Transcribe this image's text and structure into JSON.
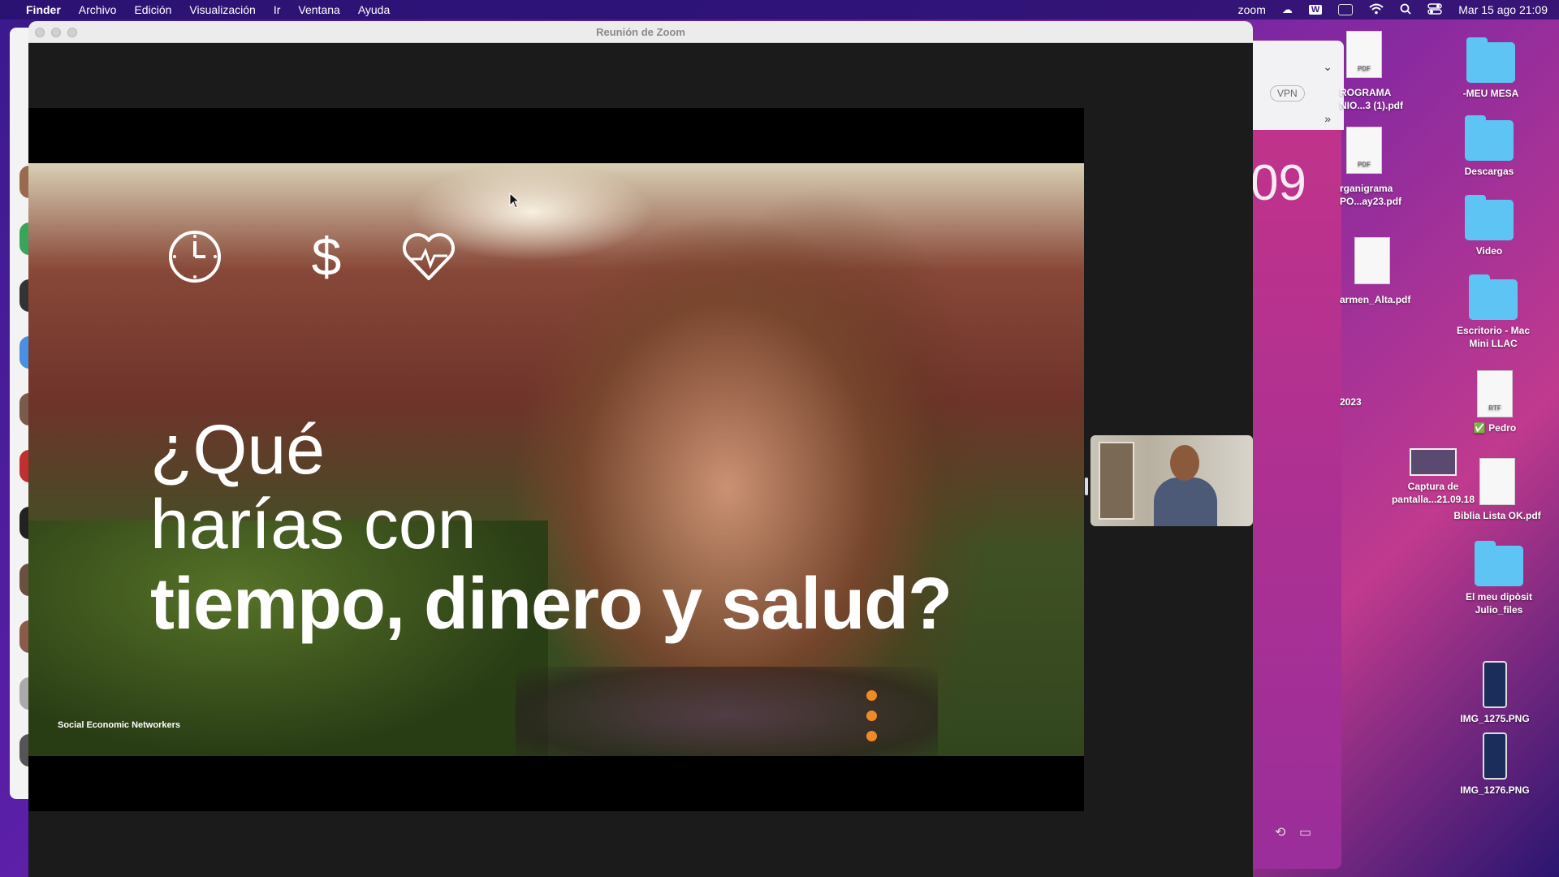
{
  "menubar": {
    "app": "Finder",
    "items": [
      "Archivo",
      "Edición",
      "Visualización",
      "Ir",
      "Ventana",
      "Ayuda"
    ],
    "zoom_label": "zoom",
    "datetime": "Mar 15 ago 21:09"
  },
  "zoom_window": {
    "title": "Reunión de Zoom"
  },
  "slide": {
    "line1": "¿Qué",
    "line2": "harías con",
    "line3": "tiempo, dinero y salud?",
    "brand": "Social Economic Networkers",
    "icons": [
      "clock-icon",
      "dollar-icon",
      "heart-pulse-icon"
    ],
    "accent_color": "#f08a24"
  },
  "background_browser": {
    "vpn_label": "VPN",
    "big_digits": "09"
  },
  "desktop": {
    "folders": {
      "meu_mesa": "-MEU MESA",
      "descargas": "Descargas",
      "video": "Video",
      "escritorio": "Escritorio - Mac Mini LLAC",
      "diposit": "El meu dipòsit Julio_files"
    },
    "files": {
      "programa": "ROGRAMA NIO...3 (1).pdf",
      "organigrama": "rganigrama PO...ay23.pdf",
      "carmen": "armen_Alta.pdf",
      "year": "2023",
      "pedro": "Pedro",
      "captura": "Captura de pantalla...21.09.18",
      "biblia": "Biblia Lista OK.pdf",
      "img1275": "IMG_1275.PNG",
      "img1276": "IMG_1276.PNG"
    },
    "doc_tags": {
      "pdf": "PDF",
      "rtf": "RTF"
    },
    "pedro_check": "✅"
  }
}
